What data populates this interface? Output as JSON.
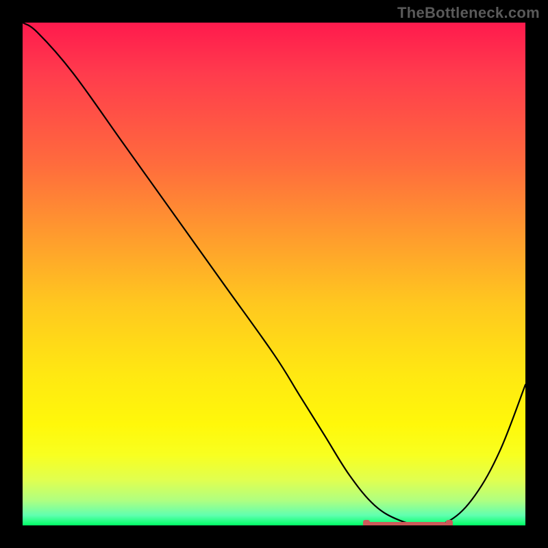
{
  "watermark": "TheBottleneck.com",
  "colors": {
    "curve_stroke": "#000000",
    "trough_marker": "#cc5a5a",
    "background_black": "#000000"
  },
  "chart_data": {
    "type": "line",
    "title": "",
    "xlabel": "",
    "ylabel": "",
    "xlim": [
      0,
      100
    ],
    "ylim": [
      0,
      100
    ],
    "series": [
      {
        "name": "bottleneck-curve",
        "x": [
          0,
          3,
          10,
          20,
          30,
          40,
          50,
          55,
          60,
          65,
          70,
          75,
          80,
          85,
          90,
          95,
          100
        ],
        "values": [
          100,
          98,
          90,
          76,
          62,
          48,
          34,
          26,
          18,
          10,
          4,
          1,
          0,
          1,
          6,
          15,
          28
        ]
      }
    ],
    "trough_region_x": [
      68,
      85
    ],
    "trough_region_y": 0,
    "annotations": []
  }
}
